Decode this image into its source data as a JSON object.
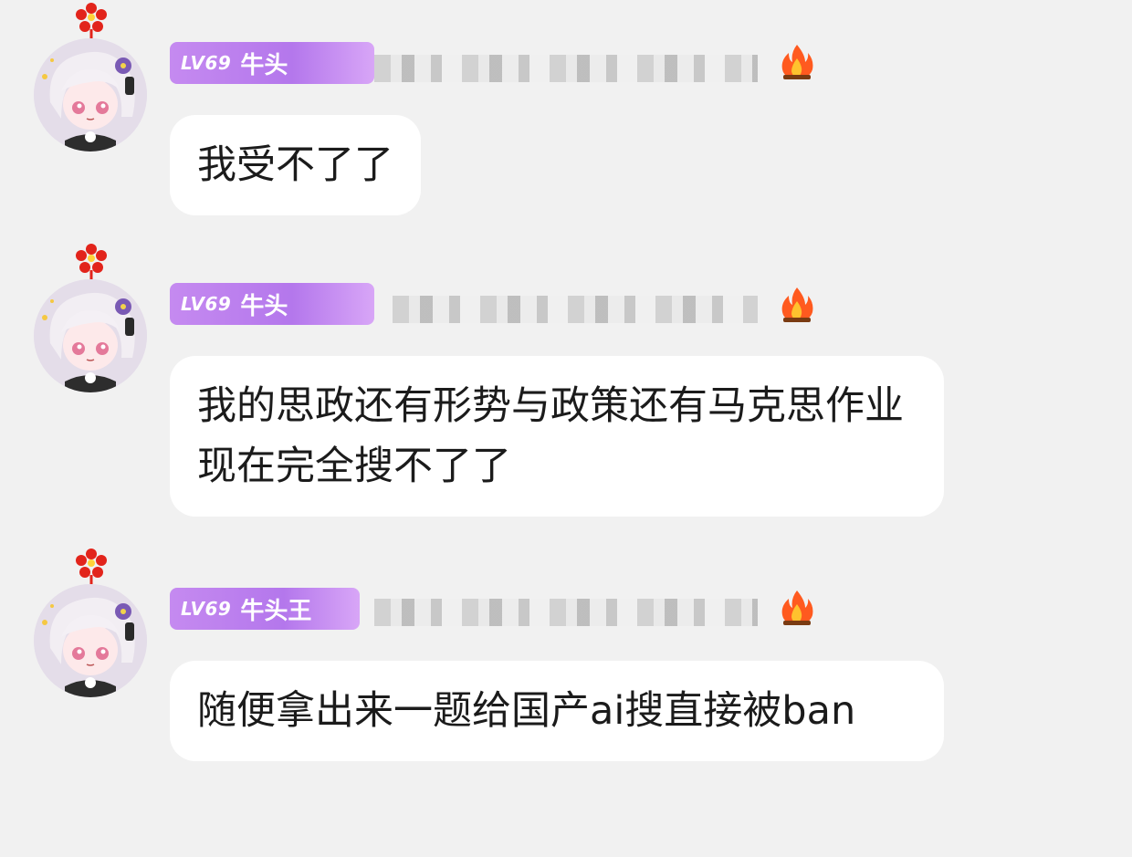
{
  "messages": [
    {
      "level": "LV69",
      "name": "牛头",
      "text": "我受不了了"
    },
    {
      "level": "LV69",
      "name": "牛头",
      "text": "我的思政还有形势与政策还有马克思作业现在完全搜不了了"
    },
    {
      "level": "LV69",
      "name": "牛头王",
      "text": "随便拿出来一题给国产ai搜直接被ban"
    }
  ],
  "icons": {
    "flower": "red-flower-icon",
    "fire": "fire-icon"
  },
  "colors": {
    "background": "#f1f1f1",
    "bubble": "#ffffff",
    "badge": "#b477ec",
    "text": "#1b1b1b"
  }
}
